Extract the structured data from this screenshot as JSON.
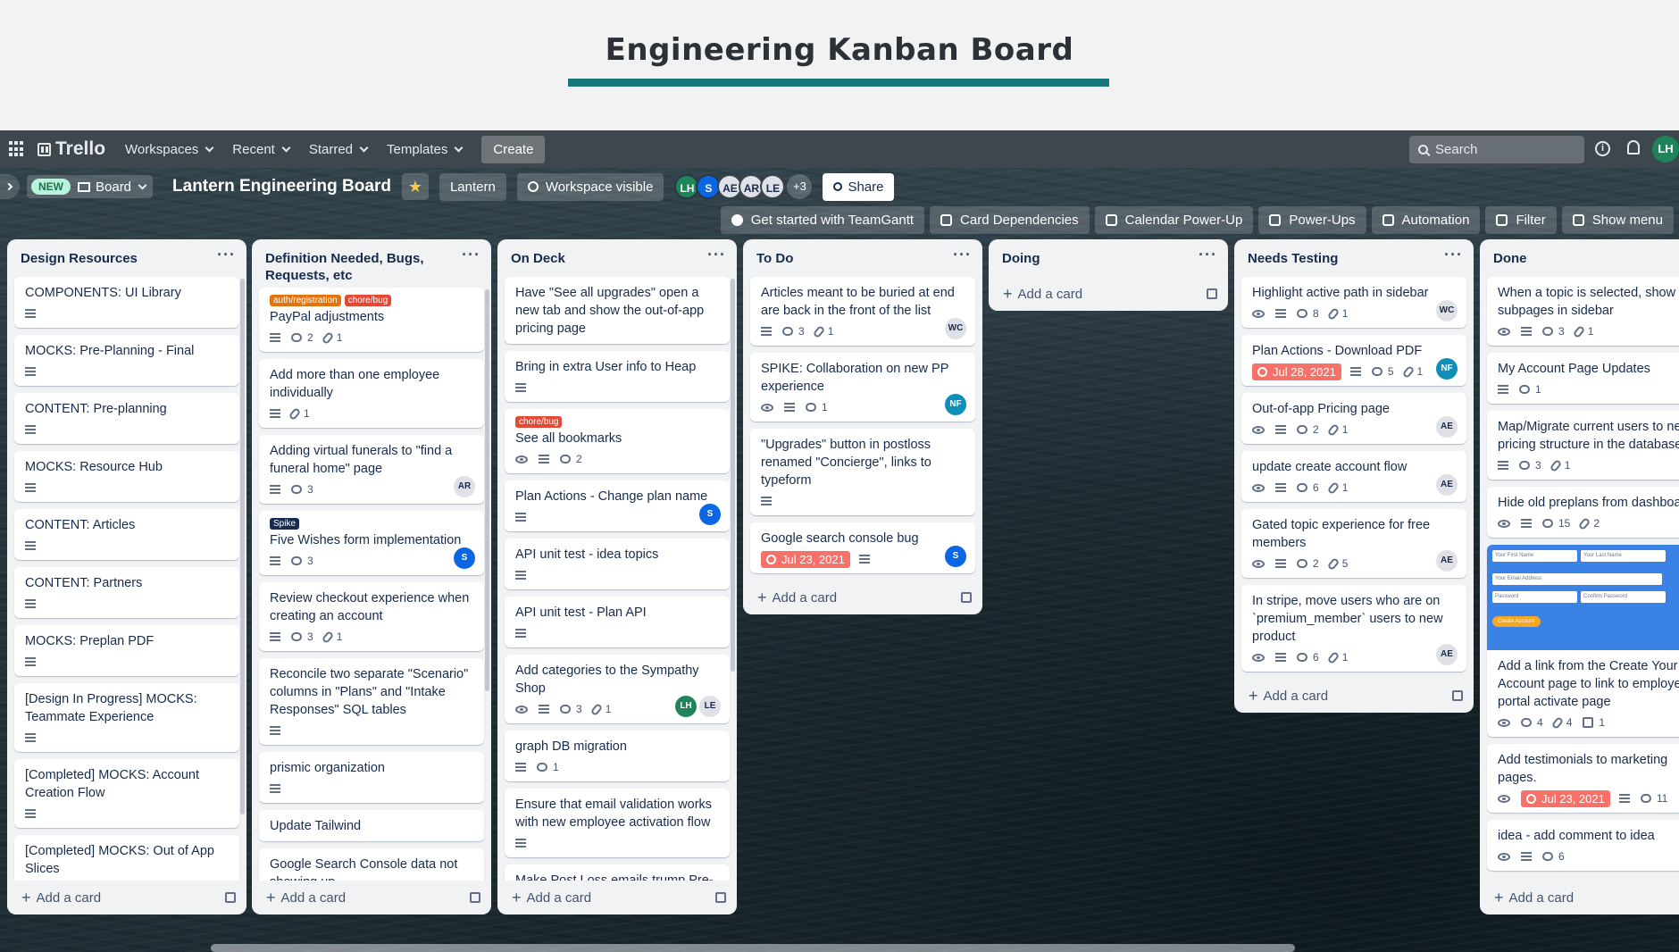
{
  "banner": {
    "title": "Engineering Kanban Board"
  },
  "nav": {
    "logo": "Trello",
    "items": [
      "Workspaces",
      "Recent",
      "Starred",
      "Templates"
    ],
    "create": "Create",
    "search_placeholder": "Search",
    "avatar": "LH"
  },
  "board": {
    "new_badge": "NEW",
    "view": "Board",
    "title": "Lantern Engineering Board",
    "workspace": "Lantern",
    "visibility": "Workspace visible",
    "members": [
      {
        "initials": "LH",
        "bg": "#1f845a",
        "fg": "#ffffff"
      },
      {
        "initials": "S",
        "bg": "#0c66e4",
        "fg": "#ffffff"
      },
      {
        "initials": "AE",
        "bg": "#dfe1e6",
        "fg": "#172b4d"
      },
      {
        "initials": "AR",
        "bg": "#dfe1e6",
        "fg": "#172b4d"
      },
      {
        "initials": "LE",
        "bg": "#dfe1e6",
        "fg": "#172b4d"
      }
    ],
    "more_members": "+3",
    "share": "Share"
  },
  "powerups": [
    "Get started with TeamGantt",
    "Card Dependencies",
    "Calendar Power-Up",
    "Power-Ups",
    "Automation",
    "Filter",
    "Show menu"
  ],
  "add_card_label": "Add a card",
  "lists": [
    {
      "title": "Design Resources",
      "cards": [
        {
          "title": "COMPONENTS: UI Library",
          "desc": true
        },
        {
          "title": "MOCKS: Pre-Planning - Final",
          "desc": true
        },
        {
          "title": "CONTENT: Pre-planning",
          "desc": true
        },
        {
          "title": "MOCKS: Resource Hub",
          "desc": true
        },
        {
          "title": "CONTENT: Articles",
          "desc": true
        },
        {
          "title": "CONTENT: Partners",
          "desc": true
        },
        {
          "title": "MOCKS: Preplan PDF",
          "desc": true
        },
        {
          "title": "[Design In Progress] MOCKS: Teammate Experience",
          "desc": true
        },
        {
          "title": "[Completed] MOCKS: Account Creation Flow",
          "desc": true
        },
        {
          "title": "[Completed] MOCKS: Out of App Slices",
          "desc": true
        }
      ]
    },
    {
      "title": "Definition Needed, Bugs, Requests, etc",
      "cards": [
        {
          "labels": [
            {
              "text": "auth/registration",
              "color": "#e2740f"
            },
            {
              "text": "chore/bug",
              "color": "#e34935"
            }
          ],
          "title": "PayPal adjustments",
          "desc": true,
          "comments": "2",
          "attachments": "1"
        },
        {
          "title": "Add more than one employee individually",
          "desc": true,
          "attachments": "1"
        },
        {
          "title": "Adding virtual funerals to \"find a funeral home\" page",
          "desc": true,
          "comments": "3",
          "avatars": [
            {
              "initials": "AR",
              "bg": "#dfe1e6",
              "fg": "#172b4d"
            }
          ]
        },
        {
          "labels": [
            {
              "text": "Spike",
              "color": "#172b4d"
            }
          ],
          "title": "Five Wishes form implementation",
          "desc": true,
          "comments": "3",
          "avatars": [
            {
              "initials": "S",
              "bg": "#0c66e4",
              "fg": "#ffffff"
            }
          ]
        },
        {
          "title": "Review checkout experience when creating an account",
          "desc": true,
          "comments": "3",
          "attachments": "1"
        },
        {
          "title": "Reconcile two separate \"Scenario\" columns in \"Plans\" and \"Intake Responses\" SQL tables",
          "desc": true
        },
        {
          "title": "prismic organization",
          "desc": true
        },
        {
          "title": "Update Tailwind"
        },
        {
          "title": "Google Search Console data not showing up"
        }
      ]
    },
    {
      "title": "On Deck",
      "cards": [
        {
          "title": "Have \"See all upgrades\" open a new tab and show the out-of-app pricing page"
        },
        {
          "title": "Bring in extra User info to Heap",
          "desc": true
        },
        {
          "labels": [
            {
              "text": "chore/bug",
              "color": "#e34935"
            }
          ],
          "title": "See all bookmarks",
          "watch": true,
          "desc": true,
          "comments": "2"
        },
        {
          "title": "Plan Actions - Change plan name",
          "desc": true,
          "avatars": [
            {
              "initials": "S",
              "bg": "#0c66e4",
              "fg": "#ffffff"
            }
          ]
        },
        {
          "title": "API unit test - idea topics",
          "desc": true
        },
        {
          "title": "API unit test - Plan API",
          "desc": true
        },
        {
          "title": "Add categories to the Sympathy Shop",
          "watch": true,
          "desc": true,
          "comments": "3",
          "attachments": "1",
          "avatars": [
            {
              "initials": "LH",
              "bg": "#1f845a",
              "fg": "#ffffff"
            },
            {
              "initials": "LE",
              "bg": "#dfe1e6",
              "fg": "#172b4d"
            }
          ]
        },
        {
          "title": "graph DB migration",
          "desc": true,
          "comments": "1"
        },
        {
          "title": "Ensure that email validation works with new employee activation flow",
          "desc": true
        },
        {
          "title": "Make Post Loss emails trump Pre-"
        }
      ]
    },
    {
      "title": "To Do",
      "cards": [
        {
          "title": "Articles meant to be buried at end are back in the front of the list",
          "desc": true,
          "comments": "3",
          "attachments": "1",
          "avatars": [
            {
              "initials": "WC",
              "bg": "#dfe1e6",
              "fg": "#172b4d"
            }
          ]
        },
        {
          "title": "SPIKE: Collaboration on new PP experience",
          "watch": true,
          "desc": true,
          "comments": "1",
          "avatars": [
            {
              "initials": "NF",
              "bg": "#0e8fb8",
              "fg": "#ffffff"
            }
          ]
        },
        {
          "title": "\"Upgrades\" button in postloss renamed \"Concierge\", links to typeform",
          "desc": true
        },
        {
          "title": "Google search console bug",
          "due": "Jul 23, 2021",
          "desc": true,
          "avatars": [
            {
              "initials": "S",
              "bg": "#0c66e4",
              "fg": "#ffffff"
            }
          ]
        }
      ]
    },
    {
      "title": "Doing",
      "cards": []
    },
    {
      "title": "Needs Testing",
      "cards": [
        {
          "title": "Highlight active path in sidebar",
          "watch": true,
          "desc": true,
          "comments": "8",
          "attachments": "1",
          "avatars": [
            {
              "initials": "WC",
              "bg": "#dfe1e6",
              "fg": "#172b4d"
            }
          ]
        },
        {
          "title": "Plan Actions - Download PDF",
          "due": "Jul 28, 2021",
          "desc": true,
          "comments": "5",
          "attachments": "1",
          "avatars": [
            {
              "initials": "NF",
              "bg": "#0e8fb8",
              "fg": "#ffffff"
            }
          ]
        },
        {
          "title": "Out-of-app Pricing page",
          "watch": true,
          "desc": true,
          "comments": "2",
          "attachments": "1",
          "avatars": [
            {
              "initials": "AE",
              "bg": "#dfe1e6",
              "fg": "#172b4d"
            }
          ]
        },
        {
          "title": "update create account flow",
          "watch": true,
          "desc": true,
          "comments": "6",
          "attachments": "1",
          "avatars": [
            {
              "initials": "AE",
              "bg": "#dfe1e6",
              "fg": "#172b4d"
            }
          ]
        },
        {
          "title": "Gated topic experience for free members",
          "watch": true,
          "desc": true,
          "comments": "2",
          "attachments": "5",
          "avatars": [
            {
              "initials": "AE",
              "bg": "#dfe1e6",
              "fg": "#172b4d"
            }
          ]
        },
        {
          "title": "In stripe, move users who are on `premium_member` users to new product",
          "watch": true,
          "desc": true,
          "comments": "6",
          "attachments": "1",
          "avatars": [
            {
              "initials": "AE",
              "bg": "#dfe1e6",
              "fg": "#172b4d"
            }
          ]
        }
      ]
    },
    {
      "title": "Done",
      "cards": [
        {
          "title": "When a topic is selected, show subpages in sidebar",
          "watch": true,
          "desc": true,
          "comments": "3",
          "attachments": "1"
        },
        {
          "title": "My Account Page Updates",
          "desc": true,
          "comments": "1"
        },
        {
          "title": "Map/Migrate current users to new pricing structure in the database",
          "desc": true,
          "comments": "3",
          "attachments": "1"
        },
        {
          "title": "Hide old preplans from dashboard",
          "watch": true,
          "desc": true,
          "comments": "15",
          "attachments": "2"
        },
        {
          "cover": {
            "fields": [
              "Your First Name",
              "Your Last Name",
              "Your Email Address",
              "Password",
              "Confirm Password"
            ],
            "button": "Create Account"
          },
          "title": "Add a link from the Create Your Account page to link to employee portal activate page",
          "watch": true,
          "comments": "4",
          "attachments": "4",
          "checklist": "1"
        },
        {
          "title": "Add testimonials to marketing pages.",
          "watch": true,
          "due": "Jul 23, 2021",
          "desc": true,
          "comments": "11"
        },
        {
          "title": "idea - add comment to idea",
          "watch": true,
          "desc": true,
          "comments": "6"
        }
      ]
    }
  ]
}
